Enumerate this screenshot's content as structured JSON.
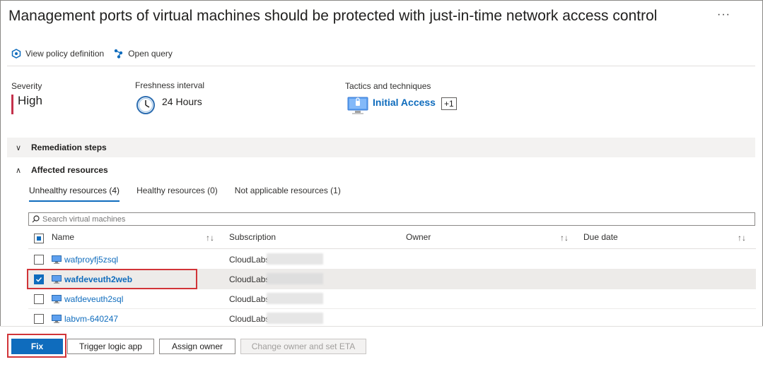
{
  "header": {
    "title": "Management ports of virtual machines should be protected with just-in-time network access control",
    "more_label": "···"
  },
  "toolbar": {
    "view_policy_label": "View policy definition",
    "open_query_label": "Open query"
  },
  "meta": {
    "severity_label": "Severity",
    "severity_value": "High",
    "freshness_label": "Freshness interval",
    "freshness_value": "24 Hours",
    "tactics_label": "Tactics and techniques",
    "tactic_value": "Initial Access",
    "tactic_extra": "+1"
  },
  "sections": {
    "remediation_label": "Remediation steps",
    "affected_label": "Affected resources"
  },
  "tabs": [
    {
      "label": "Unhealthy resources (4)",
      "active": true
    },
    {
      "label": "Healthy resources (0)",
      "active": false
    },
    {
      "label": "Not applicable resources (1)",
      "active": false
    }
  ],
  "search": {
    "placeholder": "Search virtual machines"
  },
  "table": {
    "columns": {
      "name": "Name",
      "subscription": "Subscription",
      "owner": "Owner",
      "due_date": "Due date"
    },
    "sort_glyph": "↑↓",
    "rows": [
      {
        "name": "wafproyfj5zsql",
        "subscription": "CloudLabs",
        "checked": false
      },
      {
        "name": "wafdeveuth2web",
        "subscription": "CloudLabs A",
        "checked": true
      },
      {
        "name": "wafdeveuth2sql",
        "subscription": "CloudLabs A",
        "checked": false
      },
      {
        "name": "labvm-640247",
        "subscription": "CloudLabs",
        "checked": false
      }
    ]
  },
  "actions": {
    "fix_label": "Fix",
    "trigger_label": "Trigger logic app",
    "assign_label": "Assign owner",
    "change_label": "Change owner and set ETA"
  },
  "colors": {
    "accent": "#0f6cbd",
    "severity_high": "#c4314b",
    "highlight_box": "#d13438"
  }
}
